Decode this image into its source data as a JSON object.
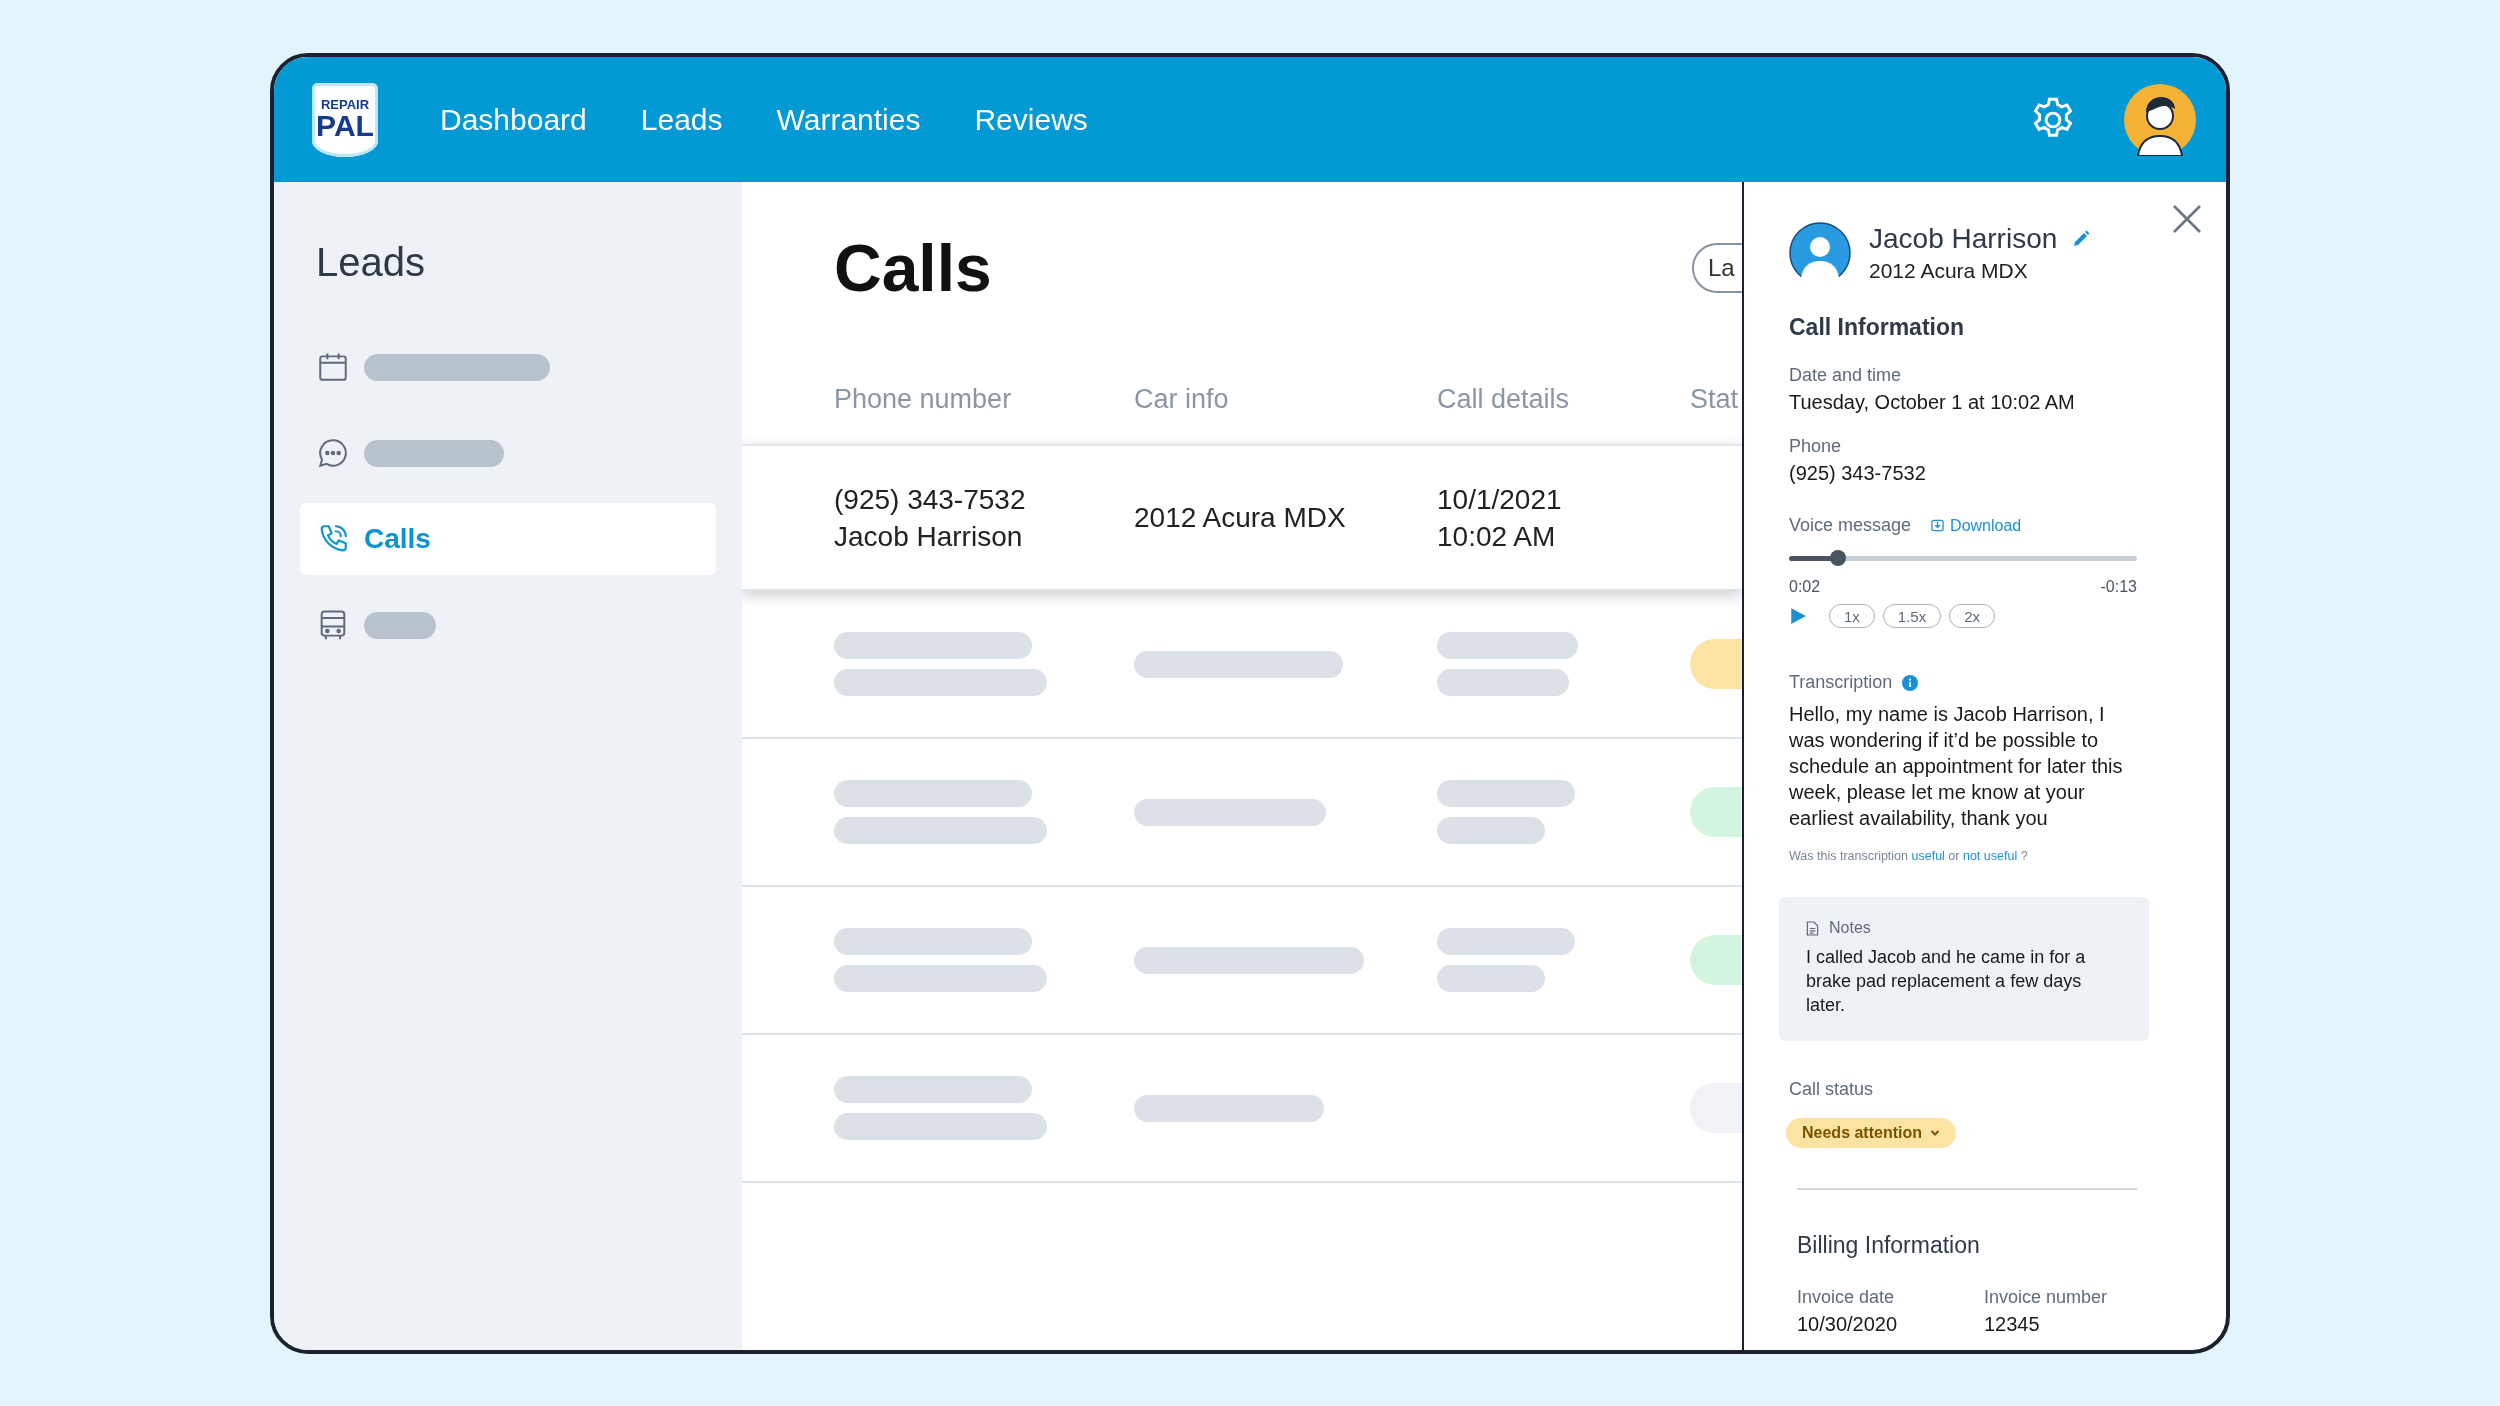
{
  "header": {
    "logo": {
      "top": "REPAIR",
      "bottom": "PAL"
    },
    "nav": [
      {
        "label": "Dashboard"
      },
      {
        "label": "Leads"
      },
      {
        "label": "Warranties"
      },
      {
        "label": "Reviews"
      }
    ]
  },
  "sidebar": {
    "title": "Leads",
    "items": [
      {
        "kind": "skeleton",
        "selected": false
      },
      {
        "kind": "skeleton",
        "selected": false
      },
      {
        "kind": "link",
        "label": "Calls",
        "selected": true
      },
      {
        "kind": "skeleton",
        "selected": false
      }
    ]
  },
  "main": {
    "title": "Calls",
    "top_button": "La",
    "table": {
      "columns": [
        "Phone number",
        "Car info",
        "Call details",
        "Stat"
      ],
      "rows": [
        {
          "kind": "data",
          "selected": true,
          "cells": [
            [
              "(925) 343-7532",
              "Jacob Harrison"
            ],
            [
              "2012 Acura MDX"
            ],
            [
              "10/1/2021",
              "10:02 AM"
            ]
          ]
        },
        {
          "kind": "skeleton",
          "selected": false,
          "color": "#fbe3a1"
        },
        {
          "kind": "skeleton",
          "selected": false,
          "color": "#d3f5df"
        },
        {
          "kind": "skeleton",
          "selected": false,
          "color": "#d3f5df"
        },
        {
          "kind": "skeleton",
          "selected": false,
          "color": "#f0f2f5"
        }
      ]
    }
  },
  "panel": {
    "contact": {
      "name": "Jacob Harrison",
      "vehicle": "2012 Acura MDX"
    },
    "section_title": "Call Information",
    "fields": [
      {
        "label": "Date and time",
        "value": "Tuesday, October 1 at 10:02 AM"
      },
      {
        "label": "Phone",
        "value": "(925) 343-7532"
      }
    ],
    "voice": {
      "label": "Voice message",
      "download": "Download",
      "level": 0.14,
      "elapsed": "0:02",
      "remaining": "-0:13",
      "speeds": [
        "1x",
        "1.5x",
        "2x"
      ]
    },
    "transcription": {
      "label": "Transcription",
      "text": "Hello, my name is Jacob Harrison, I was wondering if it’d be possible to schedule an appointment for later this week, please let me know at your earliest availability, thank you",
      "feedback": [
        {
          "kind": "text",
          "text": "Was this transcription"
        },
        {
          "kind": "link",
          "text": "useful"
        },
        {
          "kind": "text",
          "text": "or"
        },
        {
          "kind": "link",
          "text": "not useful"
        },
        {
          "kind": "punct",
          "text": "?"
        }
      ]
    },
    "notes": {
      "label": "Notes",
      "text": "I called Jacob and he came in for a brake pad replacement a few days later."
    },
    "call_status": {
      "label": "Call status",
      "value": "Needs attention"
    },
    "billing": {
      "title": "Billing Information",
      "fields": [
        {
          "label": "Invoice date",
          "value": "10/30/2020"
        },
        {
          "label": "Invoice number",
          "value": "12345"
        }
      ]
    }
  }
}
